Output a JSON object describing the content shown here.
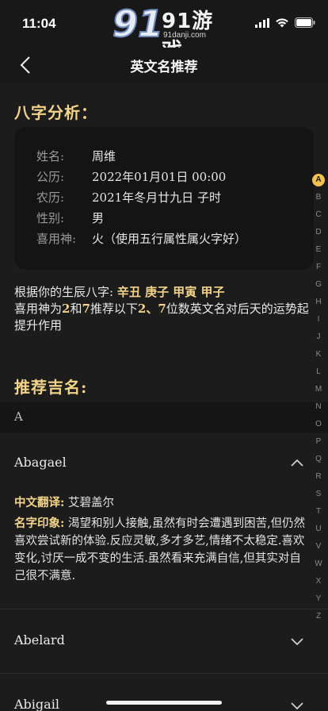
{
  "status": {
    "time": "11:04"
  },
  "watermark": {
    "brand": "91游戏",
    "site": "91danji.com"
  },
  "nav": {
    "title": "英文名推荐"
  },
  "bazi": {
    "title": "八字分析：",
    "rows": [
      {
        "label": "姓名:",
        "value": "周维"
      },
      {
        "label": "公历:",
        "value": "2022年01月01日 00:00"
      },
      {
        "label": "农历:",
        "value": "2021年冬月廿九日 子时"
      },
      {
        "label": "性别:",
        "value": "男"
      },
      {
        "label": "喜用神:",
        "value": "火（使用五行属性属火字好）"
      }
    ]
  },
  "desc": {
    "prefix": "根据你的生辰八字:",
    "bazi": "辛丑 庚子 甲寅 甲子",
    "line2_a": "喜用神为",
    "num1": "2",
    "line2_b": "和",
    "num2": "7",
    "line2_c": "推荐以下",
    "num3": "2、7",
    "line2_d": "位数英文名对后天的运势起提升作用"
  },
  "recommend": {
    "title": "推荐吉名:",
    "letter": "A",
    "names": [
      {
        "name": "Abagael",
        "expanded": true,
        "cn_label": "中文翻译:",
        "cn_value": "艾碧盖尔",
        "impression_label": "名字印象:",
        "impression_value": "渴望和别人接触,虽然有时会遭遇到困苦,但仍然喜欢尝试新的体验.反应灵敏,多才多艺,情绪不太稳定.喜欢变化,讨厌一成不变的生活.虽然看来充满自信,但其实对自己很不满意."
      },
      {
        "name": "Abelard",
        "expanded": false
      },
      {
        "name": "Abigail",
        "expanded": false
      }
    ]
  },
  "index": [
    "A",
    "B",
    "C",
    "D",
    "E",
    "F",
    "G",
    "H",
    "I",
    "J",
    "K",
    "L",
    "M",
    "N",
    "O",
    "P",
    "Q",
    "R",
    "S",
    "T",
    "U",
    "V",
    "W",
    "X",
    "Y",
    "Z"
  ],
  "colors": {
    "accent": "#f1d38a",
    "index_active": "#f1c24e",
    "background": "#1c1c1c",
    "card": "#141414"
  }
}
